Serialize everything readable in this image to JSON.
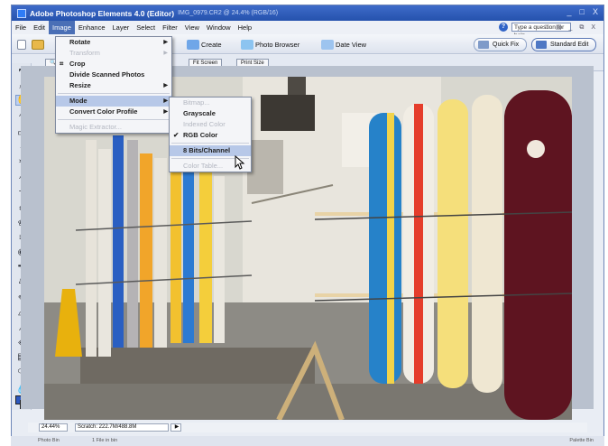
{
  "app": {
    "title": "Adobe Photoshop Elements 4.0 (Editor)",
    "doc_info": "IMG_0979.CR2 @ 24.4% (RGB/16)",
    "window_controls": [
      "_",
      "□",
      "X"
    ]
  },
  "menubar": {
    "items": [
      "File",
      "Edit",
      "Image",
      "Enhance",
      "Layer",
      "Select",
      "Filter",
      "View",
      "Window",
      "Help"
    ],
    "help_placeholder": "Type a question for help",
    "mdi_controls": "□ ▤ _ ⧉ X"
  },
  "toolbar": {
    "create_label": "Create",
    "photo_browser_label": "Photo Browser",
    "date_view_label": "Date View",
    "quick_fix_label": "Quick Fix",
    "standard_edit_label": "Standard Edit"
  },
  "options_bar": {
    "buttons": [
      "Fit Screen",
      "Print Size"
    ]
  },
  "image_menu": {
    "items": [
      {
        "label": "Rotate",
        "submenu": true,
        "disabled": false
      },
      {
        "label": "Transform",
        "submenu": true,
        "disabled": true
      },
      {
        "label": "Crop",
        "submenu": false,
        "disabled": false
      },
      {
        "label": "Divide Scanned Photos",
        "submenu": false,
        "disabled": false
      },
      {
        "label": "Resize",
        "submenu": true,
        "disabled": false
      },
      {
        "label": "Mode",
        "submenu": true,
        "disabled": false,
        "highlighted": true
      },
      {
        "label": "Convert Color Profile",
        "submenu": true,
        "disabled": false
      },
      {
        "label": "Magic Extractor...",
        "submenu": false,
        "disabled": true
      }
    ]
  },
  "mode_submenu": {
    "items": [
      {
        "label": "Bitmap...",
        "disabled": true
      },
      {
        "label": "Grayscale",
        "disabled": false
      },
      {
        "label": "Indexed Color",
        "disabled": true
      },
      {
        "label": "RGB Color",
        "disabled": false,
        "checked": true
      },
      {
        "label": "8 Bits/Channel",
        "disabled": false,
        "highlighted": true
      },
      {
        "label": "Color Table...",
        "disabled": true
      }
    ]
  },
  "status": {
    "zoom": "24.44%",
    "scratch": "Scratch: 222.7M/488.8M"
  },
  "bottom_strip": {
    "left_label": "Photo Bin",
    "mid_label": "1 File in bin",
    "right_label": "Palette Bin"
  },
  "colors": {
    "title_bar": "#2c5bb8",
    "menu_highlight": "#b7c8e8",
    "foreground_swatch": "#2d58c0"
  }
}
